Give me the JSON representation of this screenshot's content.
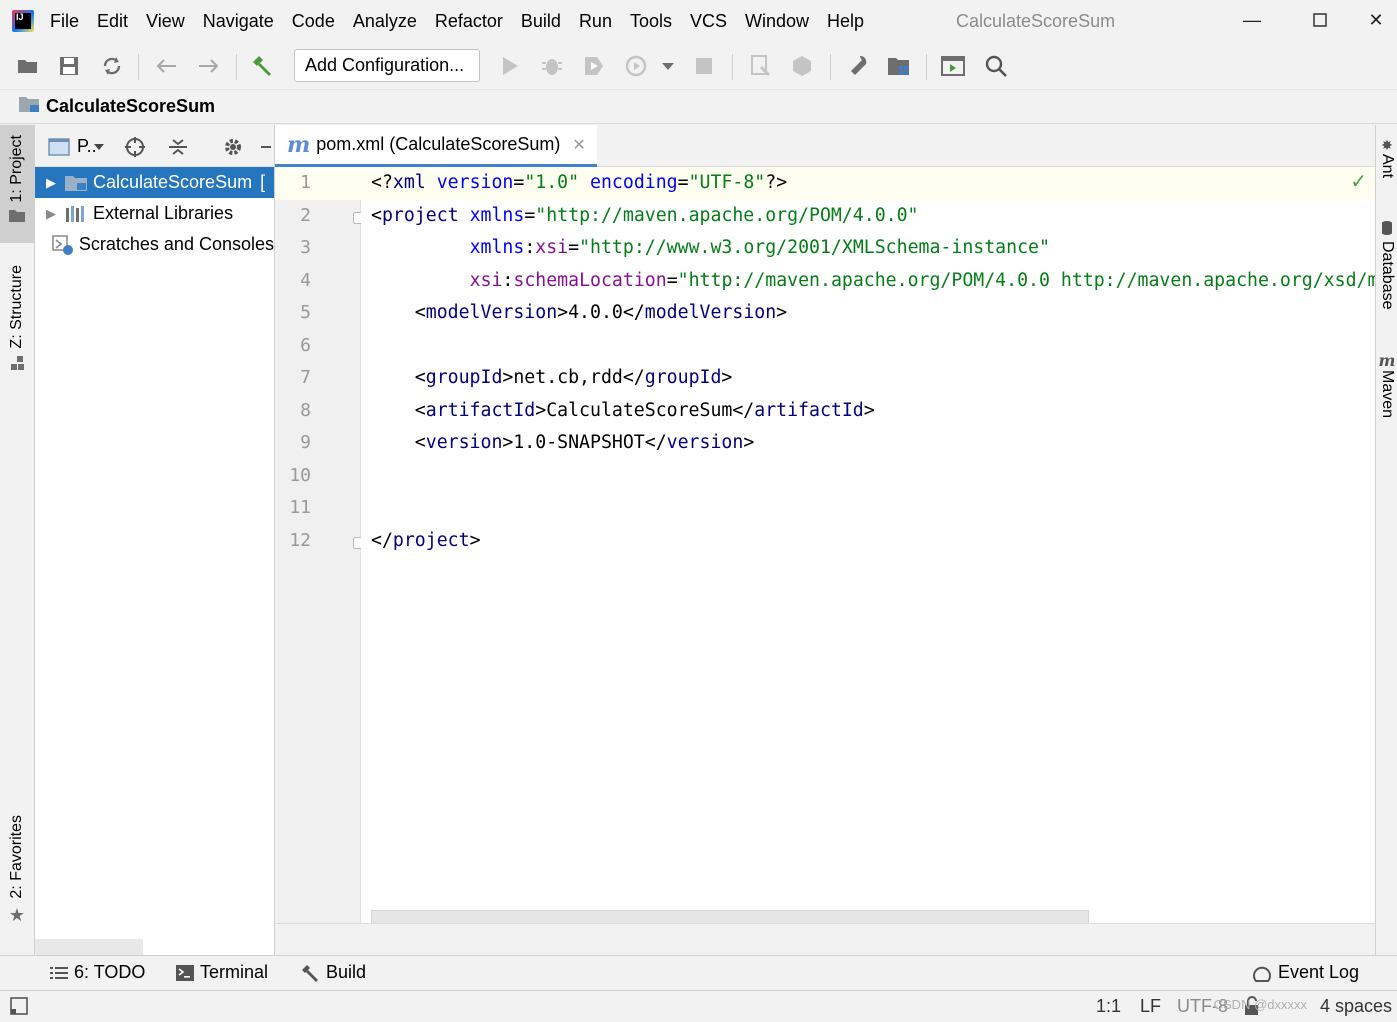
{
  "menubar": {
    "items": [
      "File",
      "Edit",
      "View",
      "Navigate",
      "Code",
      "Analyze",
      "Refactor",
      "Build",
      "Run",
      "Tools",
      "VCS",
      "Window",
      "Help"
    ],
    "window_title": "CalculateScoreSum"
  },
  "toolbar": {
    "add_configuration_label": "Add Configuration..."
  },
  "navbar": {
    "crumb": "CalculateScoreSum"
  },
  "left_strip": {
    "project_tab": "1: Project",
    "structure_tab": "Z: Structure",
    "favorites_tab": "2: Favorites"
  },
  "project_panel": {
    "title": "P..",
    "tree": [
      {
        "label": "CalculateScoreSum",
        "suffix": "[",
        "icon": "module-folder-icon",
        "selected": true
      },
      {
        "label": "External Libraries",
        "icon": "libraries-icon",
        "selected": false
      },
      {
        "label": "Scratches and Consoles",
        "icon": "scratches-icon",
        "selected": false
      }
    ]
  },
  "editor": {
    "tab_label": "pom.xml (CalculateScoreSum)",
    "line_numbers": [
      "1",
      "2",
      "3",
      "4",
      "5",
      "6",
      "7",
      "8",
      "9",
      "10",
      "11",
      "12"
    ]
  },
  "right_strip": {
    "ant_tab": "Ant",
    "database_tab": "Database",
    "maven_tab": "Maven"
  },
  "bottom_bar": {
    "todo_label": "6: TODO",
    "terminal_label": "Terminal",
    "build_label": "Build",
    "event_log_label": "Event Log"
  },
  "status_bar": {
    "position": "1:1",
    "line_separator": "LF",
    "encoding": "UTF-8",
    "indent": "4 spaces",
    "watermark": "CSDN @dxxxxx"
  },
  "colors": {
    "selection": "#2675bf",
    "xml_tag": "#000080",
    "xml_attr": "#0000ff",
    "xml_string": "#067d17",
    "xml_namespace": "#871094"
  }
}
